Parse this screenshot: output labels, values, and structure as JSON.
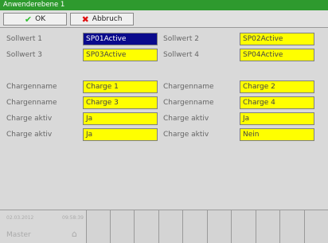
{
  "window": {
    "title": "Anwenderebene 1"
  },
  "toolbar": {
    "ok_label": "OK",
    "cancel_label": "Abbruch",
    "ok_icon": "check-icon",
    "cancel_icon": "x-icon",
    "ok_icon_color": "#2fbf2f",
    "cancel_icon_color": "#e01010"
  },
  "setpoints": [
    {
      "label": "Sollwert 1",
      "value": "SP01Active"
    },
    {
      "label": "Sollwert 2",
      "value": "SP02Active"
    },
    {
      "label": "Sollwert 3",
      "value": "SP03Active"
    },
    {
      "label": "Sollwert 4",
      "value": "SP04Active"
    }
  ],
  "batch": [
    {
      "label": "Chargenname",
      "value": "Charge 1"
    },
    {
      "label": "Chargenname",
      "value": "Charge 2"
    },
    {
      "label": "Chargenname",
      "value": "Charge 3"
    },
    {
      "label": "Chargenname",
      "value": "Charge 4"
    },
    {
      "label": "Charge aktiv",
      "value": "Ja"
    },
    {
      "label": "Charge aktiv",
      "value": "Ja"
    },
    {
      "label": "Charge aktiv",
      "value": "Ja"
    },
    {
      "label": "Charge aktiv",
      "value": "Nein"
    }
  ],
  "status": {
    "date": "02.03.2012",
    "time": "09:58:39",
    "user": "Master"
  },
  "colors": {
    "titlebar": "#2e9a2e",
    "field": "#ffff00",
    "selected_field": "#0a0a8c"
  }
}
